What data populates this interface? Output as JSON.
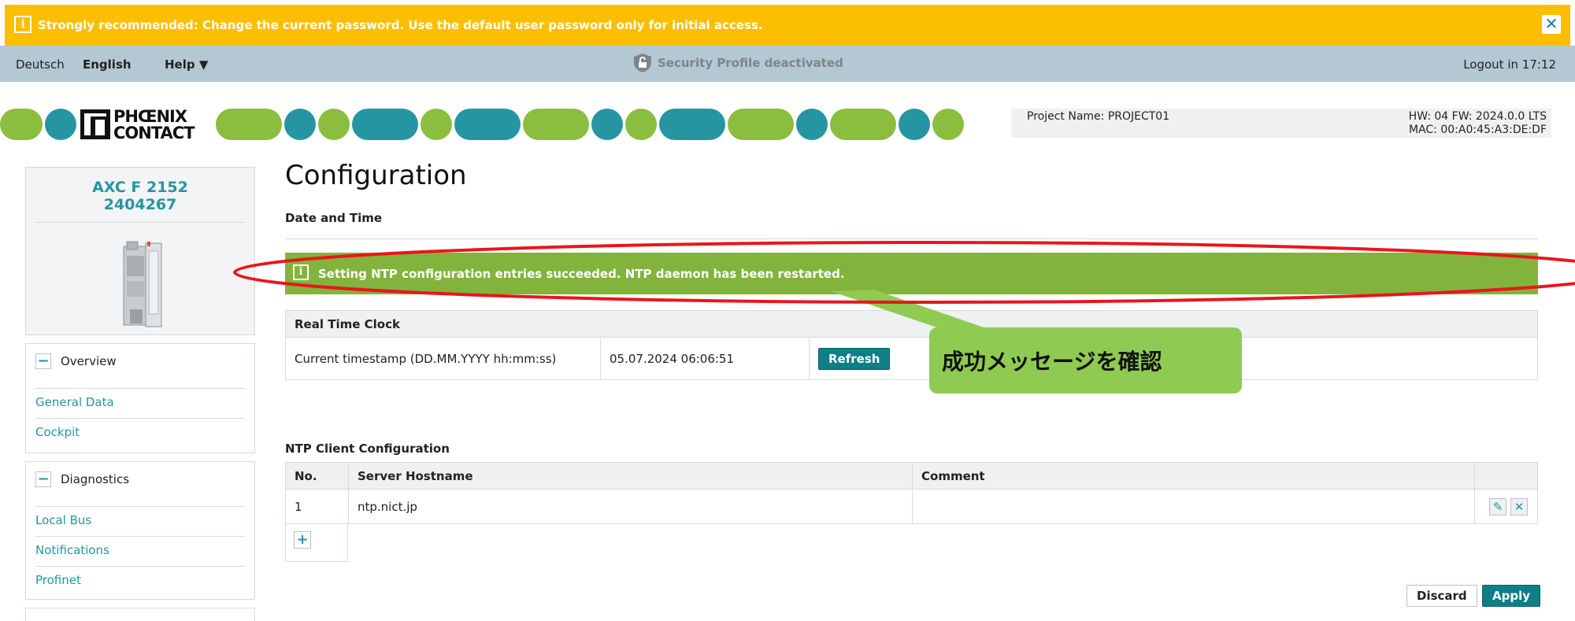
{
  "warning": {
    "text": "Strongly recommended: Change the current password. Use the default user password only for initial access.",
    "close": "✕"
  },
  "topbar": {
    "lang_de": "Deutsch",
    "lang_en": "English",
    "help": "Help ▼",
    "security": "Security Profile deactivated",
    "logout": "Logout in 17:12"
  },
  "project": {
    "name": "Project Name: PROJECT01",
    "hw_fw": "HW: 04 FW: 2024.0.0 LTS",
    "mac": "MAC: 00:A0:45:A3:DE:DF"
  },
  "logo": {
    "line1": "PHŒNIX",
    "line2": "CONTACT"
  },
  "device": {
    "model": "AXC F 2152",
    "part": "2404267"
  },
  "sidebar": {
    "overview": {
      "title": "Overview",
      "items": [
        "General Data",
        "Cockpit"
      ]
    },
    "diagnostics": {
      "title": "Diagnostics",
      "items": [
        "Local Bus",
        "Notifications",
        "Profinet"
      ]
    }
  },
  "page": {
    "title": "Configuration",
    "subtitle": "Date and Time",
    "success": "Setting NTP configuration entries succeeded. NTP daemon has been restarted."
  },
  "rtc": {
    "header": "Real Time Clock",
    "label": "Current timestamp (DD.MM.YYYY hh:mm:ss)",
    "value": "05.07.2024 06:06:51",
    "refresh": "Refresh"
  },
  "ntp": {
    "title": "NTP Client Configuration",
    "columns": [
      "No.",
      "Server Hostname",
      "Comment"
    ],
    "rows": [
      {
        "no": "1",
        "host": "ntp.nict.jp",
        "comment": ""
      }
    ]
  },
  "actions": {
    "discard": "Discard",
    "apply": "Apply"
  },
  "annotation": {
    "callout": "成功メッセージを確認"
  },
  "colors": {
    "accent": "#2596a1",
    "green": "#82b33c",
    "warning": "#fcbe00",
    "annotation_red": "#e8161d"
  }
}
